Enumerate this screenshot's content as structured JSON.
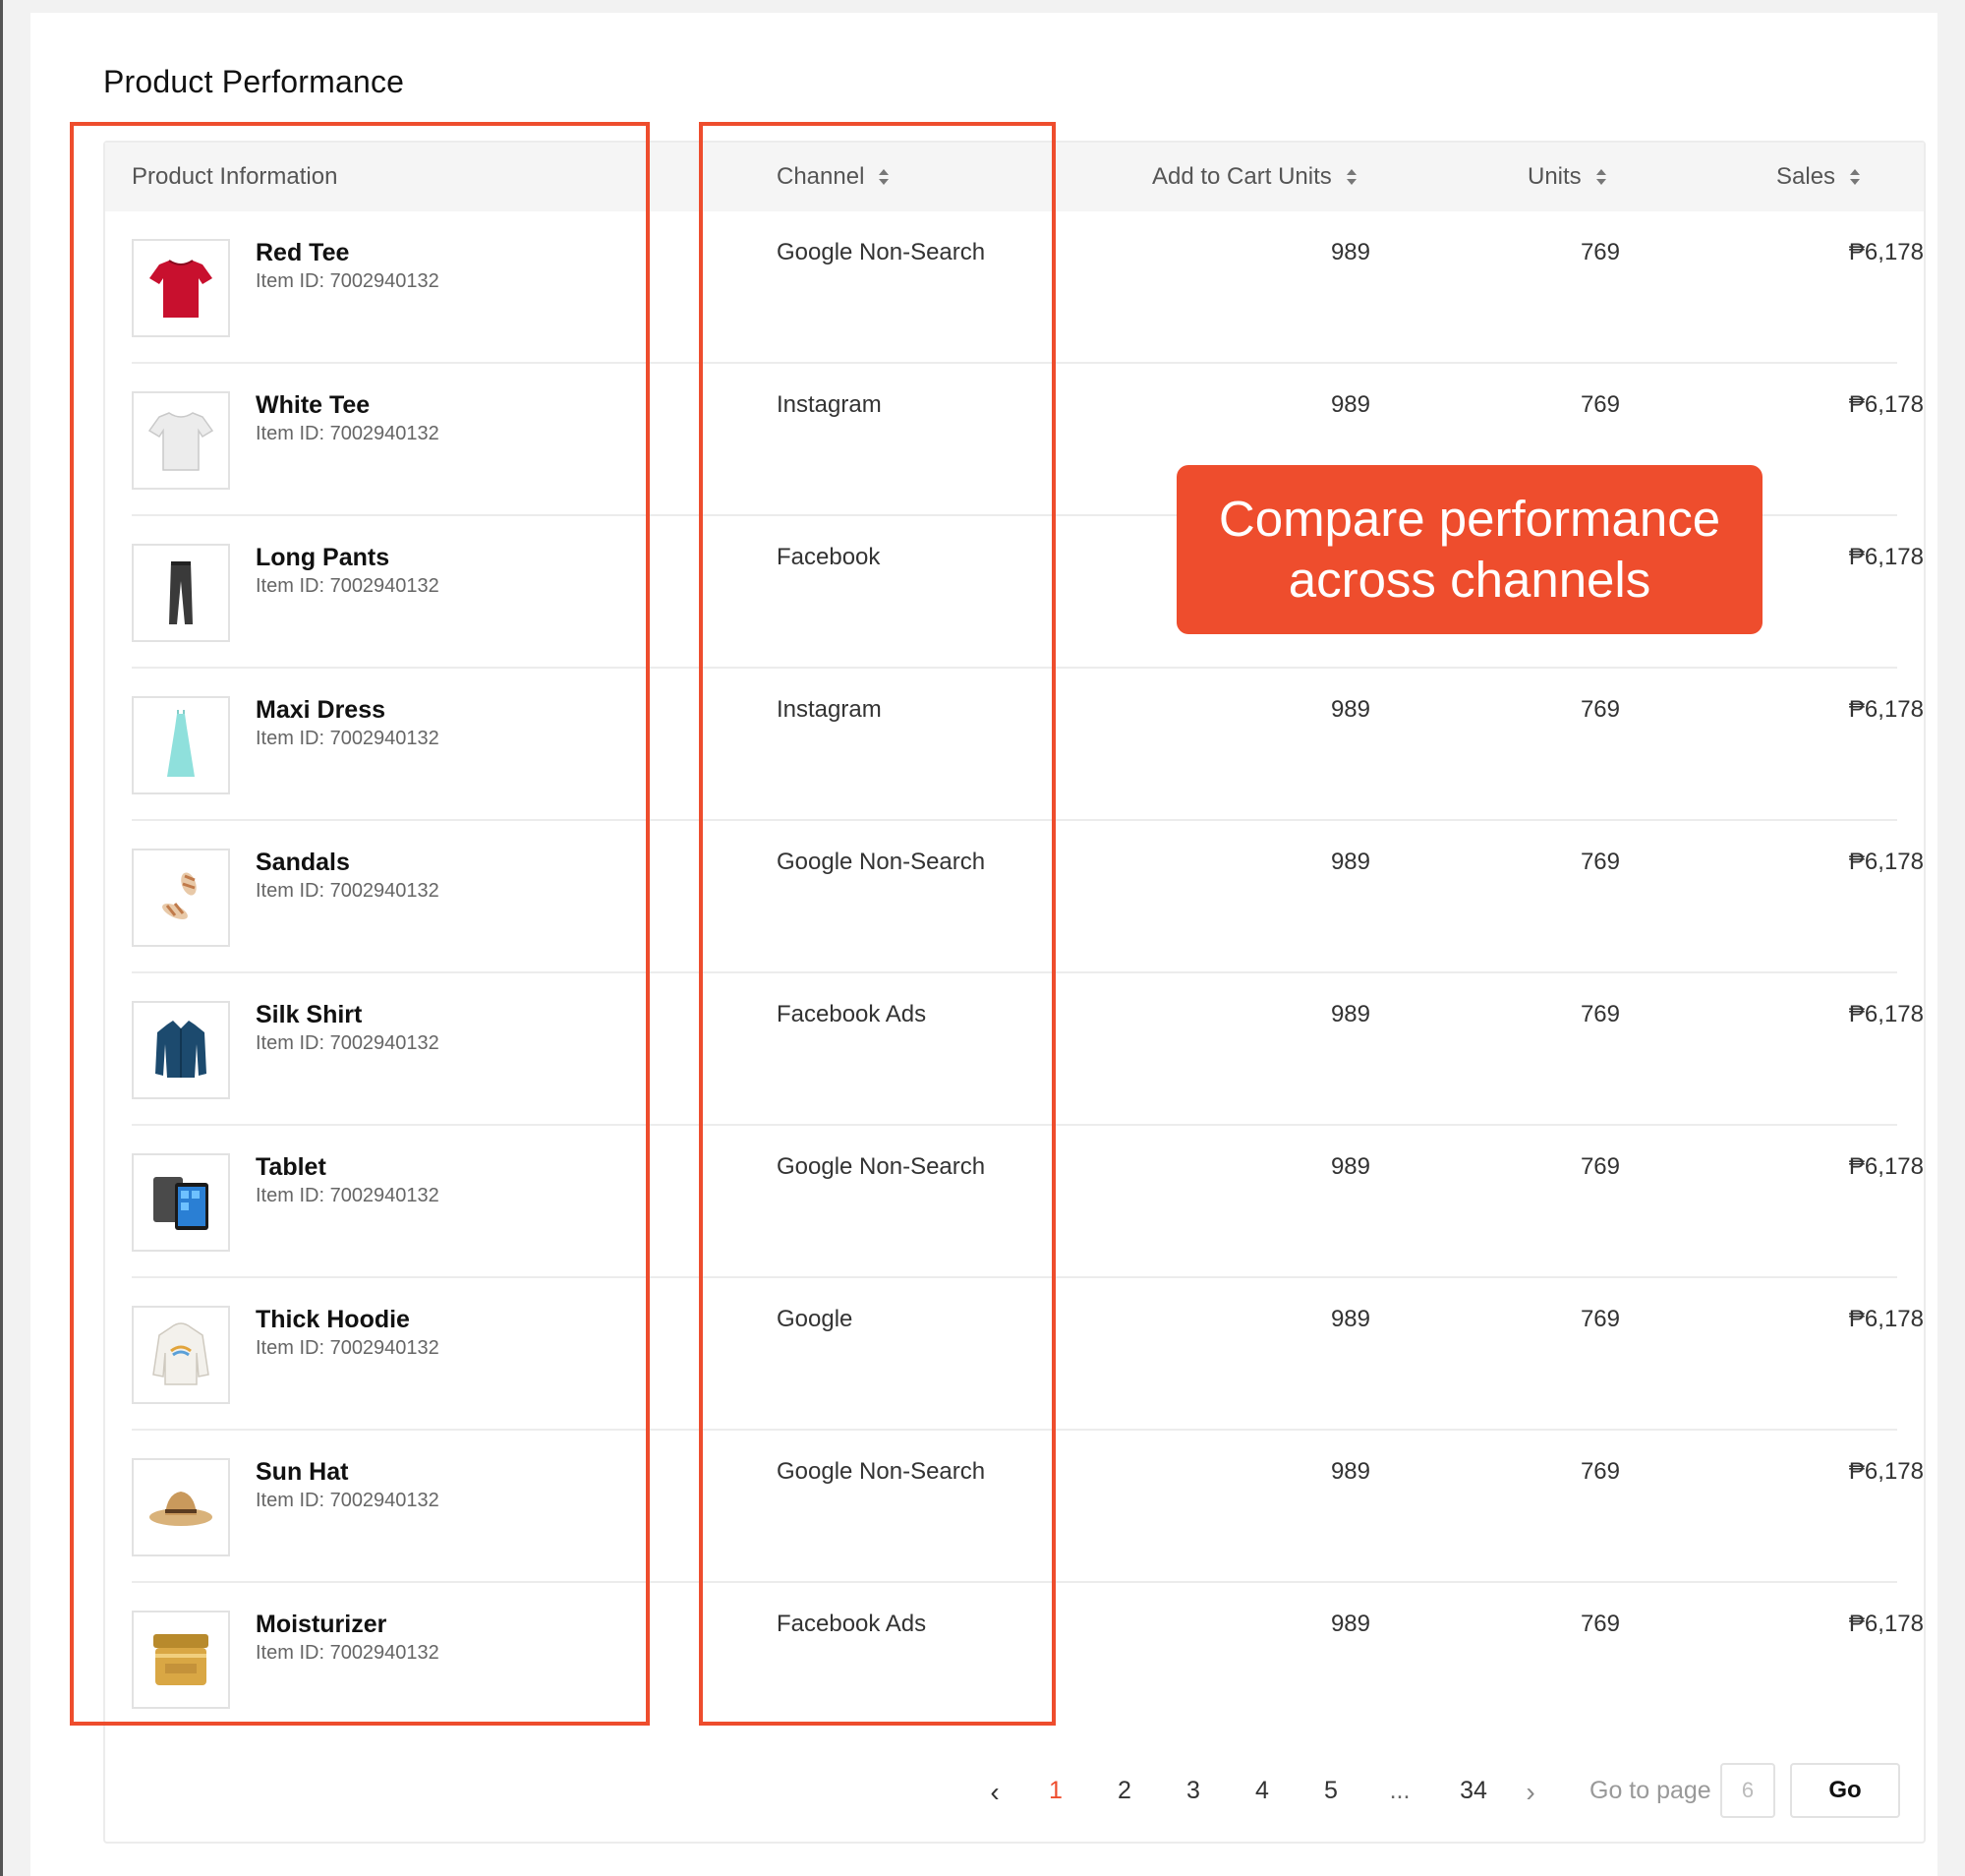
{
  "page": {
    "title": "Product Performance"
  },
  "table": {
    "headers": {
      "product_info": "Product Information",
      "channel": "Channel",
      "add_to_cart_units": "Add to Cart Units",
      "units": "Units",
      "sales": "Sales"
    },
    "rows": [
      {
        "name": "Red Tee",
        "item_id": "Item ID: 7002940132",
        "channel": "Google Non-Search",
        "atc": "989",
        "units": "769",
        "sales": "₱6,178",
        "icon": "red-tshirt-icon"
      },
      {
        "name": "White Tee",
        "item_id": "Item ID: 7002940132",
        "channel": "Instagram",
        "atc": "989",
        "units": "769",
        "sales": "₱6,178",
        "icon": "white-tshirt-icon"
      },
      {
        "name": "Long Pants",
        "item_id": "Item ID: 7002940132",
        "channel": "Facebook",
        "atc": "",
        "units": "",
        "sales": "₱6,178",
        "icon": "pants-icon"
      },
      {
        "name": "Maxi Dress",
        "item_id": "Item ID: 7002940132",
        "channel": "Instagram",
        "atc": "989",
        "units": "769",
        "sales": "₱6,178",
        "icon": "dress-icon"
      },
      {
        "name": "Sandals",
        "item_id": "Item ID: 7002940132",
        "channel": "Google Non-Search",
        "atc": "989",
        "units": "769",
        "sales": "₱6,178",
        "icon": "sandals-icon"
      },
      {
        "name": "Silk Shirt",
        "item_id": "Item ID: 7002940132",
        "channel": "Facebook Ads",
        "atc": "989",
        "units": "769",
        "sales": "₱6,178",
        "icon": "shirt-icon"
      },
      {
        "name": "Tablet",
        "item_id": "Item ID: 7002940132",
        "channel": "Google Non-Search",
        "atc": "989",
        "units": "769",
        "sales": "₱6,178",
        "icon": "tablet-icon"
      },
      {
        "name": "Thick Hoodie",
        "item_id": "Item ID: 7002940132",
        "channel": "Google",
        "atc": "989",
        "units": "769",
        "sales": "₱6,178",
        "icon": "hoodie-icon"
      },
      {
        "name": "Sun Hat",
        "item_id": "Item ID: 7002940132",
        "channel": "Google Non-Search",
        "atc": "989",
        "units": "769",
        "sales": "₱6,178",
        "icon": "hat-icon"
      },
      {
        "name": "Moisturizer",
        "item_id": "Item ID: 7002940132",
        "channel": "Facebook Ads",
        "atc": "989",
        "units": "769",
        "sales": "₱6,178",
        "icon": "moisturizer-jar-icon"
      }
    ]
  },
  "callout": {
    "line1": "Compare performance",
    "line2": "across channels"
  },
  "pagination": {
    "pages": [
      "1",
      "2",
      "3",
      "4",
      "5",
      "...",
      "34"
    ],
    "active_page": "1",
    "goto_label": "Go to page",
    "goto_placeholder": "6",
    "go_label": "Go"
  },
  "colors": {
    "accent": "#ee4d2d"
  }
}
